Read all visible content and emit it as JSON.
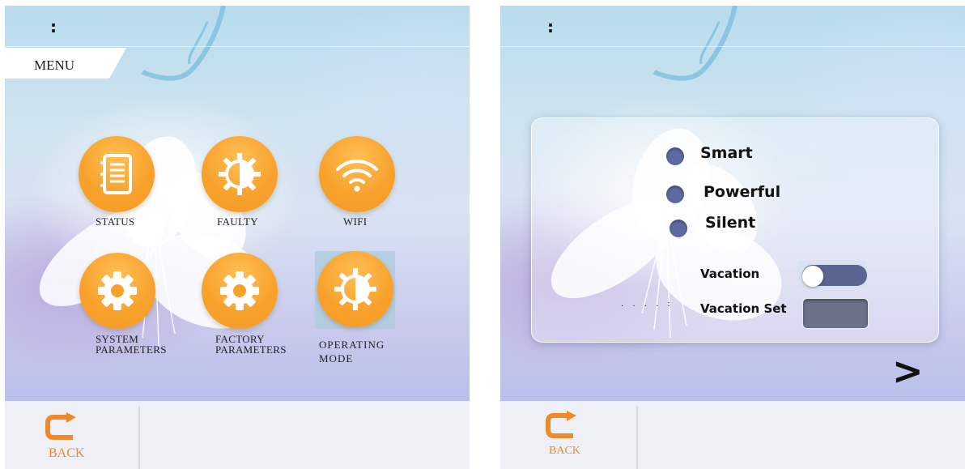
{
  "left_panel": {
    "status_colon": ":",
    "menu_title": "MENU",
    "items": [
      {
        "label": "STATUS",
        "icon": "notebook-icon"
      },
      {
        "label": "FAULTY",
        "icon": "sun-gear-icon"
      },
      {
        "label": "WIFI",
        "icon": "wifi-icon"
      },
      {
        "label": "SYSTEM\nPARAMETERS",
        "icon": "gear-icon"
      },
      {
        "label": "FACTORY\nPARAMETERS",
        "icon": "gear-icon"
      },
      {
        "label": "OPERATING\nMODE",
        "icon": "sun-gear-icon",
        "selected": true
      }
    ],
    "back_label": "BACK"
  },
  "right_panel": {
    "status_colon": ":",
    "modes": [
      "Smart",
      "Powerful",
      "Silent"
    ],
    "vacation_label": "Vacation",
    "vacation_set_label": "Vacation Set",
    "vacation_state": "off",
    "dots": ". . . . :",
    "next_label": ">",
    "back_label": "BACK"
  },
  "colors": {
    "accent_orange": "#f39b22",
    "back_orange": "#f0892a",
    "toggle_track": "#5a6592"
  }
}
